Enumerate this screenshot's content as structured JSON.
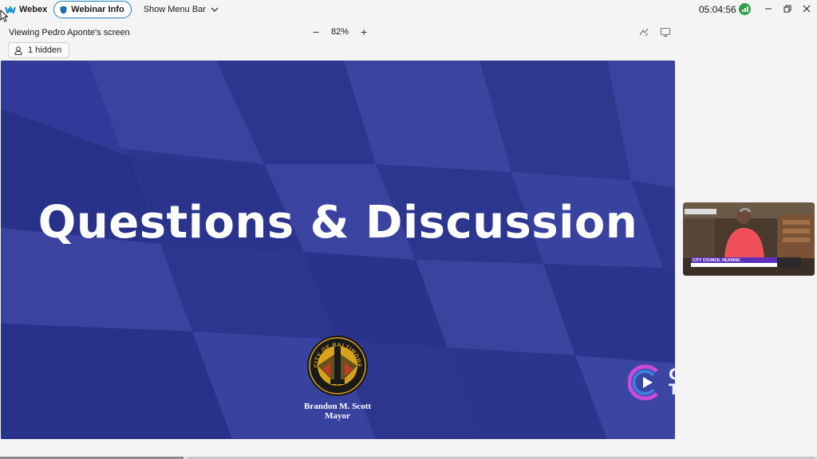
{
  "app": {
    "name": "Webex"
  },
  "topbar": {
    "webinar_info_label": "Webinar Info",
    "show_menu_bar_label": "Show Menu Bar",
    "clock": "05:04:56"
  },
  "view": {
    "viewing_label": "Viewing Pedro Aponte's screen",
    "zoom_level": "82%",
    "zoom_out": "−",
    "zoom_in": "+",
    "hidden_count_label": "1 hidden"
  },
  "slide": {
    "title": "Questions & Discussion",
    "seal_text": "CITY OF BALTIMORE",
    "mayor_name": "Brandon M. Scott",
    "mayor_title": "Mayor",
    "channel_logo_text_1": "CHARM",
    "channel_logo_text_2": "TV"
  },
  "video_thumbnail": {
    "caption": "CITY COUNCIL HEARING"
  },
  "colors": {
    "slide_background": "#2b3590",
    "accent_blue": "#1f7fbf",
    "signal_green": "#2f9f4a",
    "seal_gold": "#d8a21a"
  },
  "icons": [
    "webex-logo-icon",
    "shield-icon",
    "chevron-down-icon",
    "signal-strength-icon",
    "minimize-icon",
    "restore-icon",
    "close-icon",
    "annotate-icon",
    "pop-out-icon",
    "person-icon",
    "mouse-cursor-icon"
  ]
}
